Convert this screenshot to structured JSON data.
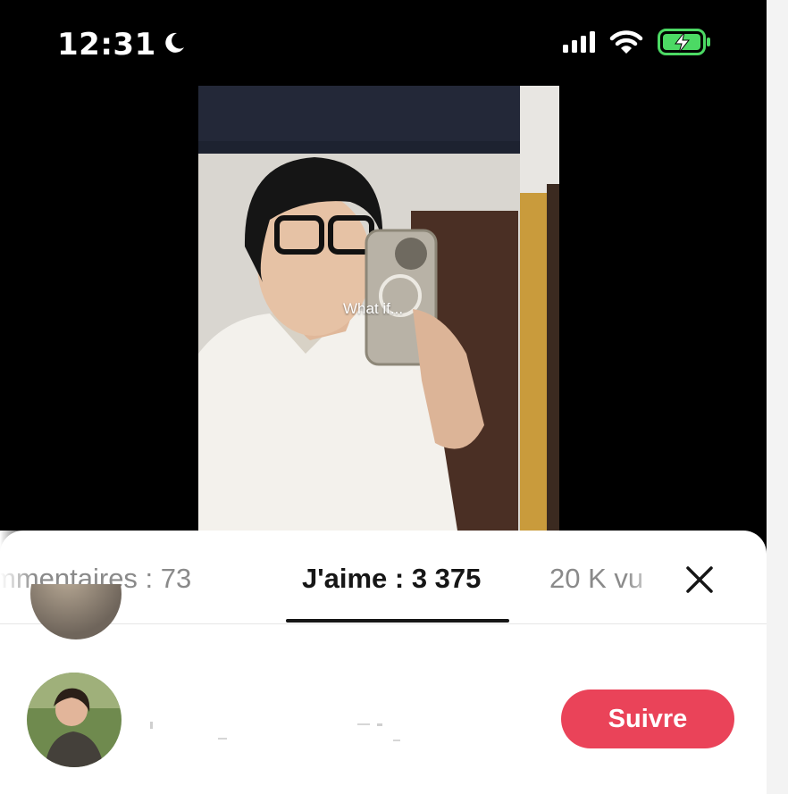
{
  "status_bar": {
    "time": "12:31",
    "focus_icon": "moon-icon",
    "signal_icon": "cellular-signal-icon",
    "wifi_icon": "wifi-icon",
    "battery_icon": "battery-charging-icon",
    "battery_color": "#4cd964"
  },
  "video": {
    "overlay_text": "What if..."
  },
  "sheet": {
    "tabs": [
      {
        "label": "mmentaires : 73",
        "active": false
      },
      {
        "label": "J'aime : 3 375",
        "active": true
      },
      {
        "label": "20 K vu",
        "active": false
      }
    ],
    "close_icon": "close-icon",
    "users": [
      {
        "name_redacted": true,
        "follow_label": "Suivre"
      }
    ]
  },
  "colors": {
    "accent": "#ea4359",
    "background": "#000000",
    "sheet": "#ffffff"
  }
}
